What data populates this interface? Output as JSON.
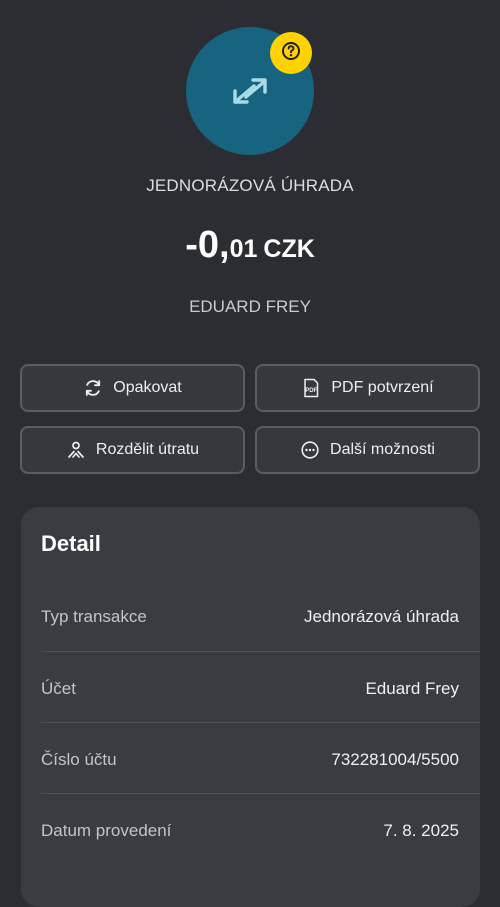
{
  "header": {
    "avatar_icon": "transfer-arrows-icon",
    "help_icon": "question-icon",
    "transaction_type": "JEDNORÁZOVÁ ÚHRADA",
    "amount_whole": "-0,",
    "amount_decimal": "01",
    "currency": "CZK",
    "counterparty": "EDUARD FREY"
  },
  "actions": {
    "repeat": {
      "label": "Opakovat",
      "icon": "refresh-icon"
    },
    "pdf": {
      "label": "PDF potvrzení",
      "icon": "pdf-icon"
    },
    "split": {
      "label": "Rozdělit útratu",
      "icon": "split-person-icon"
    },
    "more": {
      "label": "Další možnosti",
      "icon": "more-icon"
    }
  },
  "detail": {
    "title": "Detail",
    "rows": [
      {
        "label": "Typ transakce",
        "value": "Jednorázová úhrada"
      },
      {
        "label": "Účet",
        "value": "Eduard Frey"
      },
      {
        "label": "Číslo účtu",
        "value": "732281004/5500"
      },
      {
        "label": "Datum provedení",
        "value": "7. 8. 2025"
      }
    ]
  },
  "colors": {
    "background": "#2b2d33",
    "avatar": "#16647f",
    "badge": "#ffd200",
    "card": "#3a3c42"
  }
}
